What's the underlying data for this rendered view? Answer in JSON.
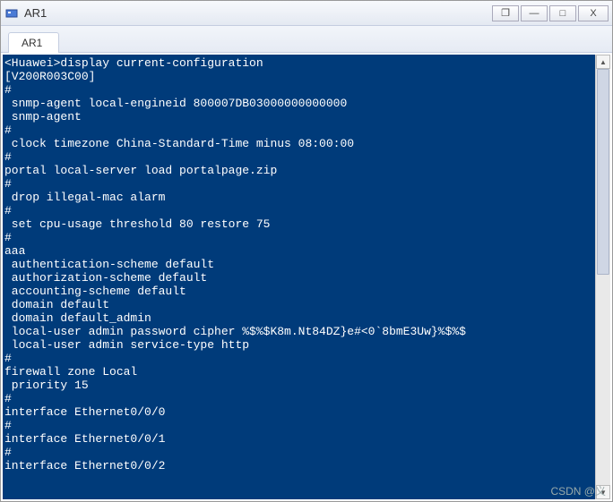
{
  "window": {
    "title": "AR1"
  },
  "tabs": [
    {
      "label": "AR1"
    }
  ],
  "titlebar_buttons": {
    "restore": "❐",
    "minimize": "—",
    "maximize": "□",
    "close": "X"
  },
  "scrollbar": {
    "up": "▲",
    "down": "▼"
  },
  "terminal": {
    "lines": [
      "<Huawei>display current-configuration",
      "[V200R003C00]",
      "#",
      " snmp-agent local-engineid 800007DB03000000000000",
      " snmp-agent",
      "#",
      " clock timezone China-Standard-Time minus 08:00:00",
      "#",
      "portal local-server load portalpage.zip",
      "#",
      " drop illegal-mac alarm",
      "#",
      " set cpu-usage threshold 80 restore 75",
      "#",
      "aaa",
      " authentication-scheme default",
      " authorization-scheme default",
      " accounting-scheme default",
      " domain default",
      " domain default_admin",
      " local-user admin password cipher %$%$K8m.Nt84DZ}e#<0`8bmE3Uw}%$%$",
      " local-user admin service-type http",
      "#",
      "firewall zone Local",
      " priority 15",
      "#",
      "interface Ethernet0/0/0",
      "#",
      "interface Ethernet0/0/1",
      "#",
      "interface Ethernet0/0/2"
    ]
  },
  "watermark": "CSDN @义"
}
